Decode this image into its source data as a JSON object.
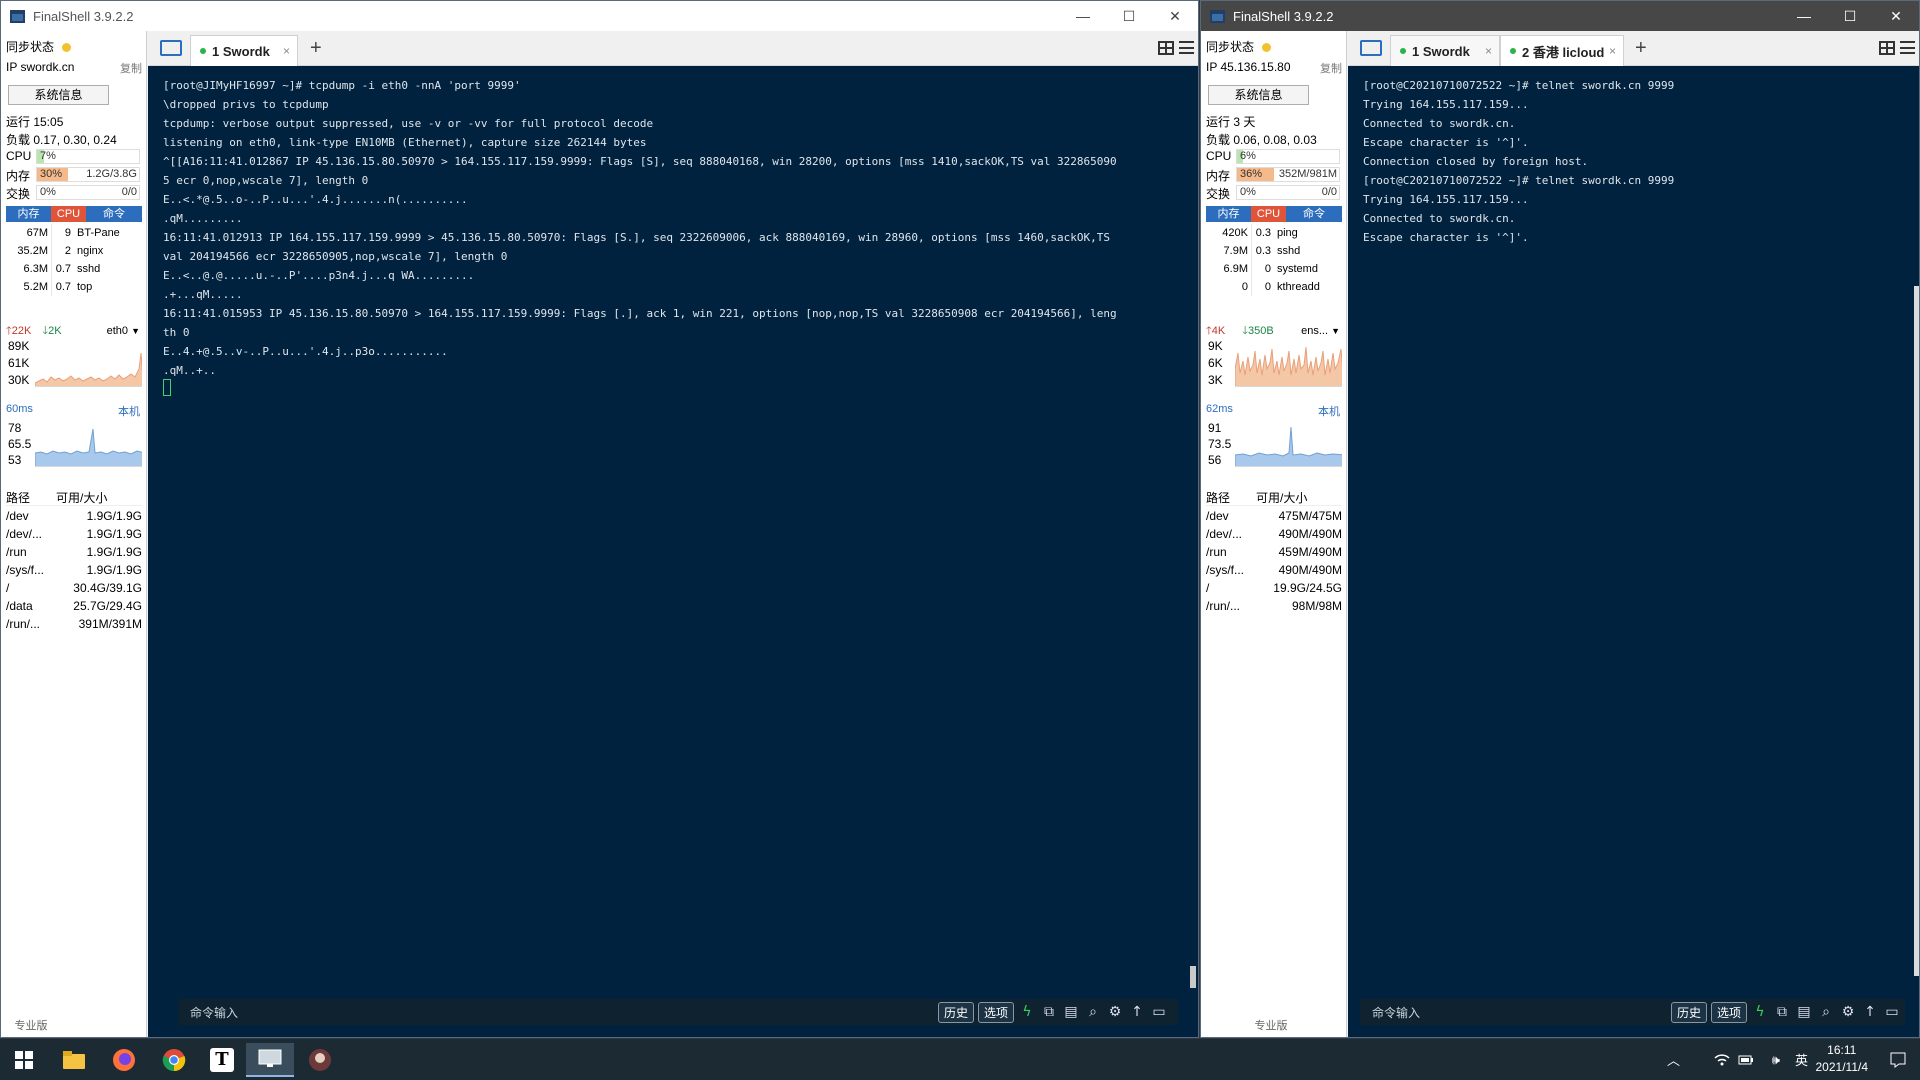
{
  "left": {
    "title": "FinalShell 3.9.2.2",
    "side": {
      "sync_label": "同步状态",
      "ip": "IP swordk.cn",
      "copy": "复制",
      "sysinfo": "系统信息",
      "uptime": "运行 15:05",
      "load": "负载 0.17, 0.30, 0.24",
      "cpu_label": "CPU",
      "cpu_pct": "7%",
      "cpu_fill": 7,
      "mem_label": "内存",
      "mem_pct": "30%",
      "mem_val": "1.2G/3.8G",
      "mem_fill": 30,
      "swap_label": "交换",
      "swap_pct": "0%",
      "swap_val": "0/0",
      "proc_headers": [
        "内存",
        "CPU",
        "命令"
      ],
      "procs": [
        {
          "mem": "67M",
          "cpu": "9",
          "cmd": "BT-Pane"
        },
        {
          "mem": "35.2M",
          "cpu": "2",
          "cmd": "nginx"
        },
        {
          "mem": "6.3M",
          "cpu": "0.7",
          "cmd": "sshd"
        },
        {
          "mem": "5.2M",
          "cpu": "0.7",
          "cmd": "top"
        }
      ],
      "net_up": "22K",
      "net_down": "2K",
      "iface": "eth0",
      "net_ticks": [
        "89K",
        "61K",
        "30K"
      ],
      "latency": "60ms",
      "latency_host": "本机",
      "lat_ticks": [
        "78",
        "65.5",
        "53"
      ],
      "fs_headers": [
        "路径",
        "可用/大小"
      ],
      "fs": [
        {
          "path": "/dev",
          "size": "1.9G/1.9G"
        },
        {
          "path": "/dev/...",
          "size": "1.9G/1.9G"
        },
        {
          "path": "/run",
          "size": "1.9G/1.9G"
        },
        {
          "path": "/sys/f...",
          "size": "1.9G/1.9G"
        },
        {
          "path": "/",
          "size": "30.4G/39.1G"
        },
        {
          "path": "/data",
          "size": "25.7G/29.4G"
        },
        {
          "path": "/run/...",
          "size": "391M/391M"
        }
      ],
      "edition": "专业版"
    },
    "tabs": [
      {
        "label": "1 Swordk",
        "close": "×"
      }
    ],
    "plus": "+",
    "terminal": [
      "[root@JIMyHF16997 ~]# tcpdump -i eth0 -nnA 'port 9999'",
      "\\dropped privs to tcpdump",
      "tcpdump: verbose output suppressed, use -v or -vv for full protocol decode",
      "listening on eth0, link-type EN10MB (Ethernet), capture size 262144 bytes",
      "^[[A16:11:41.012867 IP 45.136.15.80.50970 > 164.155.117.159.9999: Flags [S], seq 888040168, win 28200, options [mss 1410,sackOK,TS val 322865090",
      "5 ecr 0,nop,wscale 7], length 0",
      "E..<.*@.5..o-..P..u...'.4.j.......n(..........",
      ".qM.........",
      "16:11:41.012913 IP 164.155.117.159.9999 > 45.136.15.80.50970: Flags [S.], seq 2322609006, ack 888040169, win 28960, options [mss 1460,sackOK,TS",
      "val 204194566 ecr 3228650905,nop,wscale 7], length 0",
      "E..<..@.@.....u.-..P'....p3n4.j...q WA.........",
      ".+...qM.....",
      "16:11:41.015953 IP 45.136.15.80.50970 > 164.155.117.159.9999: Flags [.], ack 1, win 221, options [nop,nop,TS val 3228650908 ecr 204194566], leng",
      "th 0",
      "E..4.+@.5..v-..P..u...'.4.j..p3o...........",
      ".qM..+.."
    ],
    "cmd_label": "命令输入",
    "btn_history": "历史",
    "btn_options": "选项"
  },
  "right": {
    "title": "FinalShell 3.9.2.2",
    "side": {
      "sync_label": "同步状态",
      "ip": "IP 45.136.15.80",
      "copy": "复制",
      "sysinfo": "系统信息",
      "uptime": "运行 3 天",
      "load": "负载 0.06, 0.08, 0.03",
      "cpu_label": "CPU",
      "cpu_pct": "6%",
      "cpu_fill": 6,
      "mem_label": "内存",
      "mem_pct": "36%",
      "mem_val": "352M/981M",
      "mem_fill": 36,
      "swap_label": "交换",
      "swap_pct": "0%",
      "swap_val": "0/0",
      "proc_headers": [
        "内存",
        "CPU",
        "命令"
      ],
      "procs": [
        {
          "mem": "420K",
          "cpu": "0.3",
          "cmd": "ping"
        },
        {
          "mem": "7.9M",
          "cpu": "0.3",
          "cmd": "sshd"
        },
        {
          "mem": "6.9M",
          "cpu": "0",
          "cmd": "systemd"
        },
        {
          "mem": "0",
          "cpu": "0",
          "cmd": "kthreadd"
        }
      ],
      "net_up": "4K",
      "net_down": "350B",
      "iface": "ens...",
      "net_ticks": [
        "9K",
        "6K",
        "3K"
      ],
      "latency": "62ms",
      "latency_host": "本机",
      "lat_ticks": [
        "91",
        "73.5",
        "56"
      ],
      "fs_headers": [
        "路径",
        "可用/大小"
      ],
      "fs": [
        {
          "path": "/dev",
          "size": "475M/475M"
        },
        {
          "path": "/dev/...",
          "size": "490M/490M"
        },
        {
          "path": "/run",
          "size": "459M/490M"
        },
        {
          "path": "/sys/f...",
          "size": "490M/490M"
        },
        {
          "path": "/",
          "size": "19.9G/24.5G"
        },
        {
          "path": "/run/...",
          "size": "98M/98M"
        }
      ],
      "edition": "专业版"
    },
    "tabs": [
      {
        "label": "1 Swordk",
        "close": "×"
      },
      {
        "label": "2 香港 licloud",
        "close": "×"
      }
    ],
    "plus": "+",
    "terminal": [
      "[root@C20210710072522 ~]# telnet swordk.cn 9999",
      "Trying 164.155.117.159...",
      "Connected to swordk.cn.",
      "Escape character is '^]'.",
      "Connection closed by foreign host.",
      "[root@C20210710072522 ~]# telnet swordk.cn 9999",
      "Trying 164.155.117.159...",
      "Connected to swordk.cn.",
      "Escape character is '^]'."
    ],
    "cmd_label": "命令输入",
    "btn_history": "历史",
    "btn_options": "选项"
  },
  "taskbar": {
    "ime": "英",
    "time": "16:11",
    "date": "2021/11/4",
    "lang": "EN"
  },
  "colors": {
    "terminal_bg": "#00223f",
    "proc_mem_tab": "#2c6ebd",
    "proc_cpu_tab": "#e0553a",
    "mem_fill": "#f6b98a",
    "cpu_fill": "#b9e6b0",
    "accent": "#2c6ebd"
  }
}
